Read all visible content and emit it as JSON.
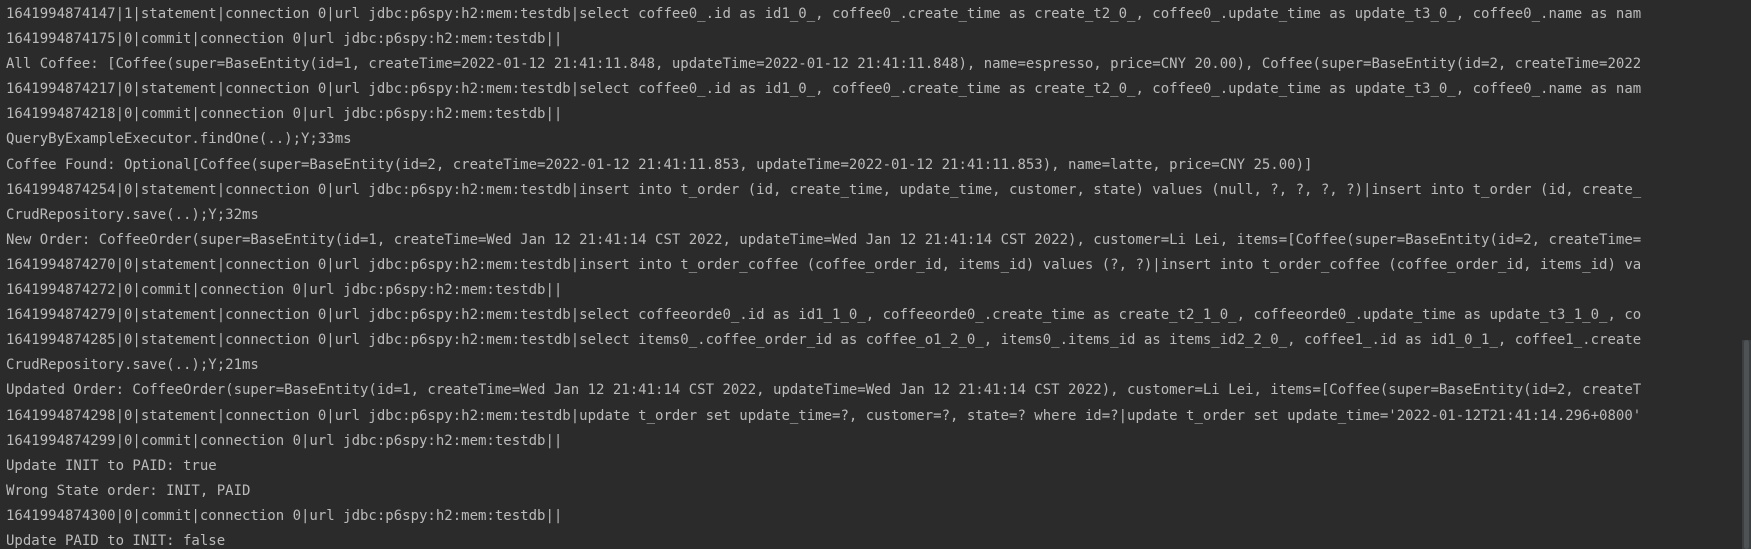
{
  "console": {
    "lines": [
      "1641994874147|1|statement|connection 0|url jdbc:p6spy:h2:mem:testdb|select coffee0_.id as id1_0_, coffee0_.create_time as create_t2_0_, coffee0_.update_time as update_t3_0_, coffee0_.name as nam",
      "1641994874175|0|commit|connection 0|url jdbc:p6spy:h2:mem:testdb||",
      "All Coffee: [Coffee(super=BaseEntity(id=1, createTime=2022-01-12 21:41:11.848, updateTime=2022-01-12 21:41:11.848), name=espresso, price=CNY 20.00), Coffee(super=BaseEntity(id=2, createTime=2022",
      "1641994874217|0|statement|connection 0|url jdbc:p6spy:h2:mem:testdb|select coffee0_.id as id1_0_, coffee0_.create_time as create_t2_0_, coffee0_.update_time as update_t3_0_, coffee0_.name as nam",
      "1641994874218|0|commit|connection 0|url jdbc:p6spy:h2:mem:testdb||",
      "QueryByExampleExecutor.findOne(..);Y;33ms",
      "Coffee Found: Optional[Coffee(super=BaseEntity(id=2, createTime=2022-01-12 21:41:11.853, updateTime=2022-01-12 21:41:11.853), name=latte, price=CNY 25.00)]",
      "1641994874254|0|statement|connection 0|url jdbc:p6spy:h2:mem:testdb|insert into t_order (id, create_time, update_time, customer, state) values (null, ?, ?, ?, ?)|insert into t_order (id, create_",
      "CrudRepository.save(..);Y;32ms",
      "New Order: CoffeeOrder(super=BaseEntity(id=1, createTime=Wed Jan 12 21:41:14 CST 2022, updateTime=Wed Jan 12 21:41:14 CST 2022), customer=Li Lei, items=[Coffee(super=BaseEntity(id=2, createTime=",
      "1641994874270|0|statement|connection 0|url jdbc:p6spy:h2:mem:testdb|insert into t_order_coffee (coffee_order_id, items_id) values (?, ?)|insert into t_order_coffee (coffee_order_id, items_id) va",
      "1641994874272|0|commit|connection 0|url jdbc:p6spy:h2:mem:testdb||",
      "1641994874279|0|statement|connection 0|url jdbc:p6spy:h2:mem:testdb|select coffeeorde0_.id as id1_1_0_, coffeeorde0_.create_time as create_t2_1_0_, coffeeorde0_.update_time as update_t3_1_0_, co",
      "1641994874285|0|statement|connection 0|url jdbc:p6spy:h2:mem:testdb|select items0_.coffee_order_id as coffee_o1_2_0_, items0_.items_id as items_id2_2_0_, coffee1_.id as id1_0_1_, coffee1_.create",
      "CrudRepository.save(..);Y;21ms",
      "Updated Order: CoffeeOrder(super=BaseEntity(id=1, createTime=Wed Jan 12 21:41:14 CST 2022, updateTime=Wed Jan 12 21:41:14 CST 2022), customer=Li Lei, items=[Coffee(super=BaseEntity(id=2, createT",
      "1641994874298|0|statement|connection 0|url jdbc:p6spy:h2:mem:testdb|update t_order set update_time=?, customer=?, state=? where id=?|update t_order set update_time='2022-01-12T21:41:14.296+0800'",
      "1641994874299|0|commit|connection 0|url jdbc:p6spy:h2:mem:testdb||",
      "Update INIT to PAID: true",
      "Wrong State order: INIT, PAID",
      "1641994874300|0|commit|connection 0|url jdbc:p6spy:h2:mem:testdb||",
      "Update PAID to INIT: false"
    ]
  },
  "colors": {
    "background": "#2b2b2b",
    "text": "#bbbbbb"
  }
}
